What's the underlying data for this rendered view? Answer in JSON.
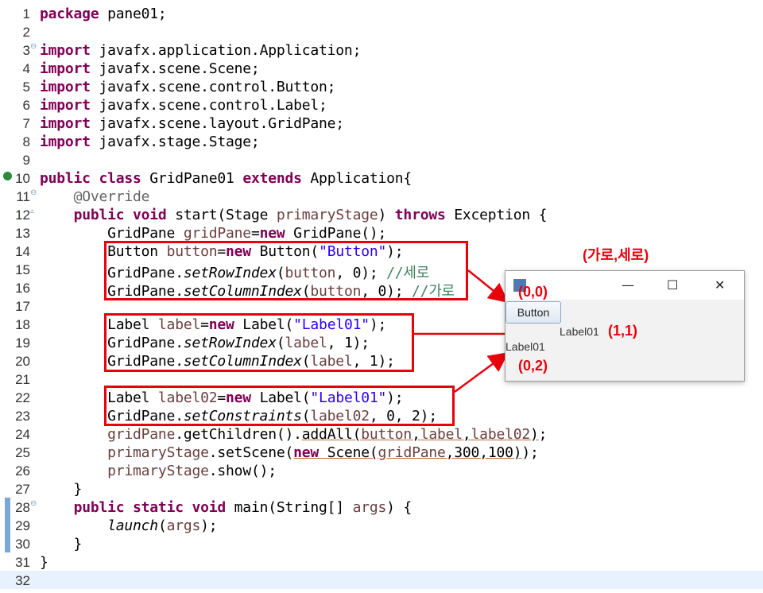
{
  "code_lines": [
    {
      "n": "1",
      "segments": [
        {
          "t": "package",
          "c": "kw"
        },
        {
          "t": " pane01;",
          "c": ""
        }
      ]
    },
    {
      "n": "2",
      "segments": []
    },
    {
      "n": "3",
      "fold": "⊖",
      "segments": [
        {
          "t": "import",
          "c": "kw"
        },
        {
          "t": " javafx.application.Application;",
          "c": ""
        }
      ]
    },
    {
      "n": "4",
      "segments": [
        {
          "t": "import",
          "c": "kw"
        },
        {
          "t": " javafx.scene.Scene;",
          "c": ""
        }
      ]
    },
    {
      "n": "5",
      "segments": [
        {
          "t": "import",
          "c": "kw"
        },
        {
          "t": " javafx.scene.control.Button;",
          "c": ""
        }
      ]
    },
    {
      "n": "6",
      "segments": [
        {
          "t": "import",
          "c": "kw"
        },
        {
          "t": " javafx.scene.control.Label;",
          "c": ""
        }
      ]
    },
    {
      "n": "7",
      "segments": [
        {
          "t": "import",
          "c": "kw"
        },
        {
          "t": " javafx.scene.layout.GridPane;",
          "c": ""
        }
      ]
    },
    {
      "n": "8",
      "segments": [
        {
          "t": "import",
          "c": "kw"
        },
        {
          "t": " javafx.stage.Stage;",
          "c": ""
        }
      ]
    },
    {
      "n": "9",
      "segments": []
    },
    {
      "n": "10",
      "marker": "run",
      "segments": [
        {
          "t": "public class",
          "c": "kw"
        },
        {
          "t": " GridPane01 ",
          "c": ""
        },
        {
          "t": "extends",
          "c": "kw"
        },
        {
          "t": " Application{",
          "c": ""
        }
      ]
    },
    {
      "n": "11",
      "fold": "⊖",
      "segments": [
        {
          "t": "    ",
          "c": ""
        },
        {
          "t": "@Override",
          "c": "ann"
        }
      ]
    },
    {
      "n": "12",
      "fold": "▵",
      "segments": [
        {
          "t": "    ",
          "c": ""
        },
        {
          "t": "public void",
          "c": "kw"
        },
        {
          "t": " start(Stage ",
          "c": ""
        },
        {
          "t": "primaryStage",
          "c": "fld"
        },
        {
          "t": ") ",
          "c": ""
        },
        {
          "t": "throws",
          "c": "kw"
        },
        {
          "t": " Exception {",
          "c": ""
        }
      ]
    },
    {
      "n": "13",
      "segments": [
        {
          "t": "        GridPane ",
          "c": ""
        },
        {
          "t": "gridPane",
          "c": "fld"
        },
        {
          "t": "=",
          "c": ""
        },
        {
          "t": "new",
          "c": "kw"
        },
        {
          "t": " GridPane();",
          "c": ""
        }
      ]
    },
    {
      "n": "14",
      "segments": [
        {
          "t": "        Button ",
          "c": ""
        },
        {
          "t": "button",
          "c": "fld"
        },
        {
          "t": "=",
          "c": ""
        },
        {
          "t": "new",
          "c": "kw"
        },
        {
          "t": " Button(",
          "c": ""
        },
        {
          "t": "\"Button\"",
          "c": "str"
        },
        {
          "t": ");",
          "c": ""
        }
      ]
    },
    {
      "n": "15",
      "segments": [
        {
          "t": "        GridPane.",
          "c": ""
        },
        {
          "t": "setRowIndex",
          "c": "it"
        },
        {
          "t": "(",
          "c": ""
        },
        {
          "t": "button",
          "c": "fld"
        },
        {
          "t": ", 0); ",
          "c": ""
        },
        {
          "t": "//세로",
          "c": "cm"
        }
      ]
    },
    {
      "n": "16",
      "segments": [
        {
          "t": "        GridPane.",
          "c": ""
        },
        {
          "t": "setColumnIndex",
          "c": "it"
        },
        {
          "t": "(",
          "c": ""
        },
        {
          "t": "button",
          "c": "fld"
        },
        {
          "t": ", 0); ",
          "c": ""
        },
        {
          "t": "//가로",
          "c": "cm"
        }
      ]
    },
    {
      "n": "17",
      "segments": []
    },
    {
      "n": "18",
      "segments": [
        {
          "t": "        Label ",
          "c": ""
        },
        {
          "t": "label",
          "c": "fld"
        },
        {
          "t": "=",
          "c": ""
        },
        {
          "t": "new",
          "c": "kw"
        },
        {
          "t": " Label(",
          "c": ""
        },
        {
          "t": "\"Label01\"",
          "c": "str"
        },
        {
          "t": ");",
          "c": ""
        }
      ]
    },
    {
      "n": "19",
      "segments": [
        {
          "t": "        GridPane.",
          "c": ""
        },
        {
          "t": "setRowIndex",
          "c": "it"
        },
        {
          "t": "(",
          "c": ""
        },
        {
          "t": "label",
          "c": "fld"
        },
        {
          "t": ", 1);",
          "c": ""
        }
      ]
    },
    {
      "n": "20",
      "segments": [
        {
          "t": "        GridPane.",
          "c": ""
        },
        {
          "t": "setColumnIndex",
          "c": "it"
        },
        {
          "t": "(",
          "c": ""
        },
        {
          "t": "label",
          "c": "fld"
        },
        {
          "t": ", 1);",
          "c": ""
        }
      ]
    },
    {
      "n": "21",
      "segments": []
    },
    {
      "n": "22",
      "segments": [
        {
          "t": "        Label ",
          "c": ""
        },
        {
          "t": "label02",
          "c": "fld"
        },
        {
          "t": "=",
          "c": ""
        },
        {
          "t": "new",
          "c": "kw"
        },
        {
          "t": " Label(",
          "c": ""
        },
        {
          "t": "\"Label01\"",
          "c": "str"
        },
        {
          "t": ");",
          "c": ""
        }
      ]
    },
    {
      "n": "23",
      "segments": [
        {
          "t": "        GridPane.",
          "c": ""
        },
        {
          "t": "setConstraints",
          "c": "it"
        },
        {
          "t": "(",
          "c": ""
        },
        {
          "t": "label02",
          "c": "fld"
        },
        {
          "t": ", 0, 2);",
          "c": ""
        }
      ]
    },
    {
      "n": "24",
      "segments": [
        {
          "t": "        ",
          "c": ""
        },
        {
          "t": "gridPane",
          "c": "fld"
        },
        {
          "t": ".getChildren().",
          "c": ""
        },
        {
          "t": "addAll(",
          "c": "ul"
        },
        {
          "t": "button",
          "c": "fld ul"
        },
        {
          "t": ",",
          "c": "ul"
        },
        {
          "t": "label",
          "c": "fld ul"
        },
        {
          "t": ",",
          "c": "ul"
        },
        {
          "t": "label02",
          "c": "fld ul"
        },
        {
          "t": ")",
          "c": "ul"
        },
        {
          "t": ";",
          "c": ""
        }
      ]
    },
    {
      "n": "25",
      "segments": [
        {
          "t": "        ",
          "c": ""
        },
        {
          "t": "primaryStage",
          "c": "fld"
        },
        {
          "t": ".setScene(",
          "c": ""
        },
        {
          "t": "new",
          "c": "kw ul"
        },
        {
          "t": " Scene(",
          "c": "ul"
        },
        {
          "t": "gridPane",
          "c": "fld ul"
        },
        {
          "t": ",300,100)",
          "c": "ul"
        },
        {
          "t": ");",
          "c": ""
        }
      ]
    },
    {
      "n": "26",
      "segments": [
        {
          "t": "        ",
          "c": ""
        },
        {
          "t": "primaryStage",
          "c": "fld"
        },
        {
          "t": ".show();",
          "c": ""
        }
      ]
    },
    {
      "n": "27",
      "segments": [
        {
          "t": "    }",
          "c": ""
        }
      ]
    },
    {
      "n": "28",
      "bar": true,
      "fold": "⊖",
      "segments": [
        {
          "t": "    ",
          "c": ""
        },
        {
          "t": "public static void",
          "c": "kw"
        },
        {
          "t": " main(String[] ",
          "c": ""
        },
        {
          "t": "args",
          "c": "fld"
        },
        {
          "t": ") {",
          "c": ""
        }
      ]
    },
    {
      "n": "29",
      "bar": true,
      "segments": [
        {
          "t": "        ",
          "c": ""
        },
        {
          "t": "launch",
          "c": "it"
        },
        {
          "t": "(",
          "c": ""
        },
        {
          "t": "args",
          "c": "fld"
        },
        {
          "t": ");",
          "c": ""
        }
      ]
    },
    {
      "n": "30",
      "bar": true,
      "segments": [
        {
          "t": "    }",
          "c": ""
        }
      ]
    },
    {
      "n": "31",
      "segments": [
        {
          "t": "}",
          "c": ""
        }
      ]
    },
    {
      "n": "32",
      "current": true,
      "segments": []
    }
  ],
  "annotations": {
    "axes_label": "(가로,세로)",
    "coord_button": "(0,0)",
    "coord_label": "(1,1)",
    "coord_label02": "(0,2)"
  },
  "fx_window": {
    "minimize": "—",
    "maximize": "☐",
    "close": "✕",
    "button_text": "Button",
    "label_text": "Label01",
    "label02_text": "Label01"
  },
  "colors": {
    "annotation_red": "#e8000b",
    "keyword": "#7f0055",
    "string": "#2a00ff",
    "comment": "#3f7f5f"
  }
}
